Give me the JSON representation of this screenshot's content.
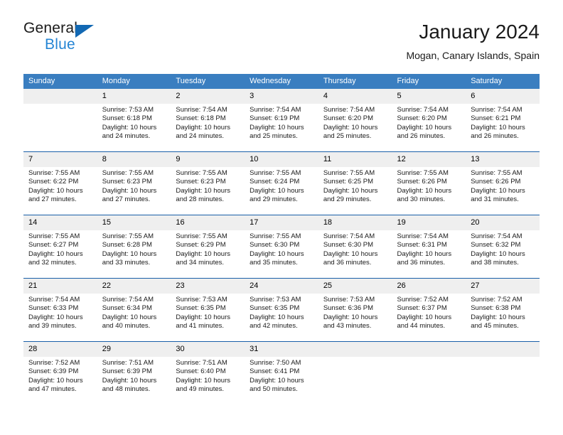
{
  "logo": {
    "word_top": "General",
    "word_bottom": "Blue",
    "triangle_color": "#1268b3",
    "blue_color": "#2585d4"
  },
  "header": {
    "title": "January 2024",
    "subtitle": "Mogan, Canary Islands, Spain"
  },
  "theme": {
    "header_bg": "#3a7ec0",
    "week_divider": "#1a5fa8",
    "daynum_bg": "#efefef"
  },
  "weekday_headers": [
    "Sunday",
    "Monday",
    "Tuesday",
    "Wednesday",
    "Thursday",
    "Friday",
    "Saturday"
  ],
  "labels": {
    "sunrise_prefix": "Sunrise:",
    "sunset_prefix": "Sunset:",
    "daylight_prefix": "Daylight:"
  },
  "weeks": [
    [
      {
        "day": "",
        "sunrise": "",
        "sunset": "",
        "daylight_line1": "",
        "daylight_line2": ""
      },
      {
        "day": "1",
        "sunrise": "Sunrise: 7:53 AM",
        "sunset": "Sunset: 6:18 PM",
        "daylight_line1": "Daylight: 10 hours",
        "daylight_line2": "and 24 minutes."
      },
      {
        "day": "2",
        "sunrise": "Sunrise: 7:54 AM",
        "sunset": "Sunset: 6:18 PM",
        "daylight_line1": "Daylight: 10 hours",
        "daylight_line2": "and 24 minutes."
      },
      {
        "day": "3",
        "sunrise": "Sunrise: 7:54 AM",
        "sunset": "Sunset: 6:19 PM",
        "daylight_line1": "Daylight: 10 hours",
        "daylight_line2": "and 25 minutes."
      },
      {
        "day": "4",
        "sunrise": "Sunrise: 7:54 AM",
        "sunset": "Sunset: 6:20 PM",
        "daylight_line1": "Daylight: 10 hours",
        "daylight_line2": "and 25 minutes."
      },
      {
        "day": "5",
        "sunrise": "Sunrise: 7:54 AM",
        "sunset": "Sunset: 6:20 PM",
        "daylight_line1": "Daylight: 10 hours",
        "daylight_line2": "and 26 minutes."
      },
      {
        "day": "6",
        "sunrise": "Sunrise: 7:54 AM",
        "sunset": "Sunset: 6:21 PM",
        "daylight_line1": "Daylight: 10 hours",
        "daylight_line2": "and 26 minutes."
      }
    ],
    [
      {
        "day": "7",
        "sunrise": "Sunrise: 7:55 AM",
        "sunset": "Sunset: 6:22 PM",
        "daylight_line1": "Daylight: 10 hours",
        "daylight_line2": "and 27 minutes."
      },
      {
        "day": "8",
        "sunrise": "Sunrise: 7:55 AM",
        "sunset": "Sunset: 6:23 PM",
        "daylight_line1": "Daylight: 10 hours",
        "daylight_line2": "and 27 minutes."
      },
      {
        "day": "9",
        "sunrise": "Sunrise: 7:55 AM",
        "sunset": "Sunset: 6:23 PM",
        "daylight_line1": "Daylight: 10 hours",
        "daylight_line2": "and 28 minutes."
      },
      {
        "day": "10",
        "sunrise": "Sunrise: 7:55 AM",
        "sunset": "Sunset: 6:24 PM",
        "daylight_line1": "Daylight: 10 hours",
        "daylight_line2": "and 29 minutes."
      },
      {
        "day": "11",
        "sunrise": "Sunrise: 7:55 AM",
        "sunset": "Sunset: 6:25 PM",
        "daylight_line1": "Daylight: 10 hours",
        "daylight_line2": "and 29 minutes."
      },
      {
        "day": "12",
        "sunrise": "Sunrise: 7:55 AM",
        "sunset": "Sunset: 6:26 PM",
        "daylight_line1": "Daylight: 10 hours",
        "daylight_line2": "and 30 minutes."
      },
      {
        "day": "13",
        "sunrise": "Sunrise: 7:55 AM",
        "sunset": "Sunset: 6:26 PM",
        "daylight_line1": "Daylight: 10 hours",
        "daylight_line2": "and 31 minutes."
      }
    ],
    [
      {
        "day": "14",
        "sunrise": "Sunrise: 7:55 AM",
        "sunset": "Sunset: 6:27 PM",
        "daylight_line1": "Daylight: 10 hours",
        "daylight_line2": "and 32 minutes."
      },
      {
        "day": "15",
        "sunrise": "Sunrise: 7:55 AM",
        "sunset": "Sunset: 6:28 PM",
        "daylight_line1": "Daylight: 10 hours",
        "daylight_line2": "and 33 minutes."
      },
      {
        "day": "16",
        "sunrise": "Sunrise: 7:55 AM",
        "sunset": "Sunset: 6:29 PM",
        "daylight_line1": "Daylight: 10 hours",
        "daylight_line2": "and 34 minutes."
      },
      {
        "day": "17",
        "sunrise": "Sunrise: 7:55 AM",
        "sunset": "Sunset: 6:30 PM",
        "daylight_line1": "Daylight: 10 hours",
        "daylight_line2": "and 35 minutes."
      },
      {
        "day": "18",
        "sunrise": "Sunrise: 7:54 AM",
        "sunset": "Sunset: 6:30 PM",
        "daylight_line1": "Daylight: 10 hours",
        "daylight_line2": "and 36 minutes."
      },
      {
        "day": "19",
        "sunrise": "Sunrise: 7:54 AM",
        "sunset": "Sunset: 6:31 PM",
        "daylight_line1": "Daylight: 10 hours",
        "daylight_line2": "and 36 minutes."
      },
      {
        "day": "20",
        "sunrise": "Sunrise: 7:54 AM",
        "sunset": "Sunset: 6:32 PM",
        "daylight_line1": "Daylight: 10 hours",
        "daylight_line2": "and 38 minutes."
      }
    ],
    [
      {
        "day": "21",
        "sunrise": "Sunrise: 7:54 AM",
        "sunset": "Sunset: 6:33 PM",
        "daylight_line1": "Daylight: 10 hours",
        "daylight_line2": "and 39 minutes."
      },
      {
        "day": "22",
        "sunrise": "Sunrise: 7:54 AM",
        "sunset": "Sunset: 6:34 PM",
        "daylight_line1": "Daylight: 10 hours",
        "daylight_line2": "and 40 minutes."
      },
      {
        "day": "23",
        "sunrise": "Sunrise: 7:53 AM",
        "sunset": "Sunset: 6:35 PM",
        "daylight_line1": "Daylight: 10 hours",
        "daylight_line2": "and 41 minutes."
      },
      {
        "day": "24",
        "sunrise": "Sunrise: 7:53 AM",
        "sunset": "Sunset: 6:35 PM",
        "daylight_line1": "Daylight: 10 hours",
        "daylight_line2": "and 42 minutes."
      },
      {
        "day": "25",
        "sunrise": "Sunrise: 7:53 AM",
        "sunset": "Sunset: 6:36 PM",
        "daylight_line1": "Daylight: 10 hours",
        "daylight_line2": "and 43 minutes."
      },
      {
        "day": "26",
        "sunrise": "Sunrise: 7:52 AM",
        "sunset": "Sunset: 6:37 PM",
        "daylight_line1": "Daylight: 10 hours",
        "daylight_line2": "and 44 minutes."
      },
      {
        "day": "27",
        "sunrise": "Sunrise: 7:52 AM",
        "sunset": "Sunset: 6:38 PM",
        "daylight_line1": "Daylight: 10 hours",
        "daylight_line2": "and 45 minutes."
      }
    ],
    [
      {
        "day": "28",
        "sunrise": "Sunrise: 7:52 AM",
        "sunset": "Sunset: 6:39 PM",
        "daylight_line1": "Daylight: 10 hours",
        "daylight_line2": "and 47 minutes."
      },
      {
        "day": "29",
        "sunrise": "Sunrise: 7:51 AM",
        "sunset": "Sunset: 6:39 PM",
        "daylight_line1": "Daylight: 10 hours",
        "daylight_line2": "and 48 minutes."
      },
      {
        "day": "30",
        "sunrise": "Sunrise: 7:51 AM",
        "sunset": "Sunset: 6:40 PM",
        "daylight_line1": "Daylight: 10 hours",
        "daylight_line2": "and 49 minutes."
      },
      {
        "day": "31",
        "sunrise": "Sunrise: 7:50 AM",
        "sunset": "Sunset: 6:41 PM",
        "daylight_line1": "Daylight: 10 hours",
        "daylight_line2": "and 50 minutes."
      },
      {
        "day": "",
        "sunrise": "",
        "sunset": "",
        "daylight_line1": "",
        "daylight_line2": ""
      },
      {
        "day": "",
        "sunrise": "",
        "sunset": "",
        "daylight_line1": "",
        "daylight_line2": ""
      },
      {
        "day": "",
        "sunrise": "",
        "sunset": "",
        "daylight_line1": "",
        "daylight_line2": ""
      }
    ]
  ]
}
